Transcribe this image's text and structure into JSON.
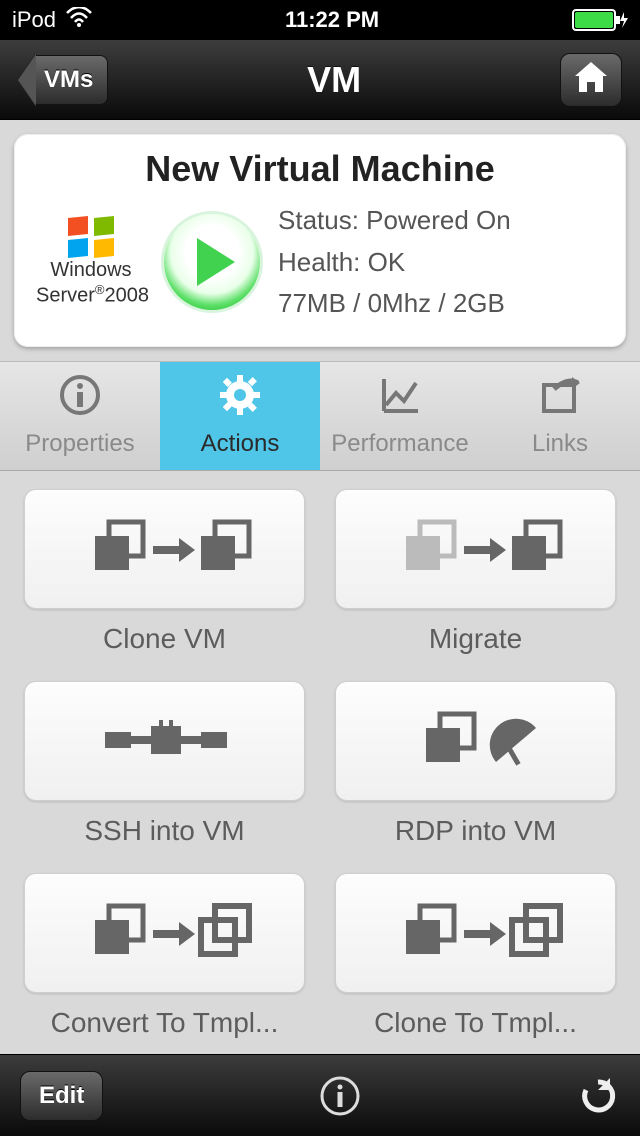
{
  "status_bar": {
    "carrier": "iPod",
    "time": "11:22 PM"
  },
  "nav": {
    "back_label": "VMs",
    "title": "VM"
  },
  "summary": {
    "name": "New Virtual Machine",
    "os_line1": "Windows",
    "os_line2_a": "Server",
    "os_line2_b": "2008",
    "status_label": "Status:",
    "status_value": "Powered On",
    "health_label": "Health:",
    "health_value": "OK",
    "resources": "77MB / 0Mhz / 2GB"
  },
  "tabs": [
    {
      "label": "Properties",
      "icon": "info-icon",
      "active": false
    },
    {
      "label": "Actions",
      "icon": "gear-icon",
      "active": true
    },
    {
      "label": "Performance",
      "icon": "chart-icon",
      "active": false
    },
    {
      "label": "Links",
      "icon": "share-icon",
      "active": false
    }
  ],
  "actions": [
    {
      "label": "Clone VM",
      "icon": "clone"
    },
    {
      "label": "Migrate",
      "icon": "migrate"
    },
    {
      "label": "SSH into VM",
      "icon": "ssh"
    },
    {
      "label": "RDP into VM",
      "icon": "rdp"
    },
    {
      "label": "Convert To Tmpl...",
      "icon": "to_tmpl"
    },
    {
      "label": "Clone To Tmpl...",
      "icon": "to_tmpl"
    }
  ],
  "toolbar": {
    "edit_label": "Edit"
  }
}
